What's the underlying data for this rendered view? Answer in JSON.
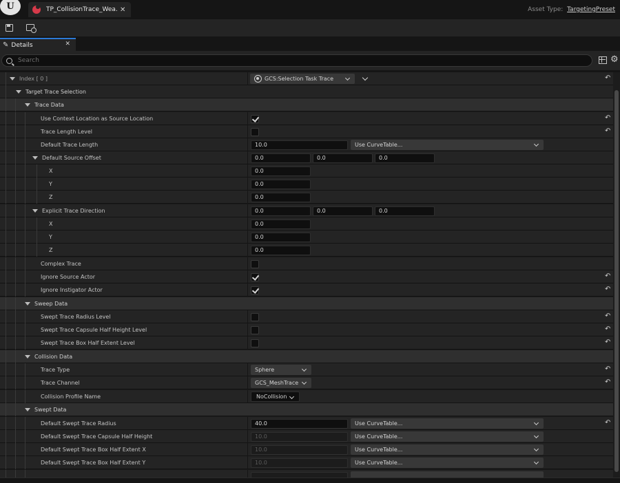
{
  "window": {
    "tab_title": "TP_CollisionTrace_Wea...",
    "tab_close": "✕",
    "asset_type_label": "Asset Type:",
    "asset_type_value": "TargetingPreset"
  },
  "panel": {
    "tab_label": "Details",
    "tab_close": "✕",
    "search_placeholder": "Search"
  },
  "index_row": {
    "label": "Index [ 0 ]",
    "task_value": "GCS:Selection Task Trace"
  },
  "categories": {
    "target_trace_selection": "Target Trace Selection",
    "trace_data": "Trace Data",
    "sweep_data": "Sweep Data",
    "collision_data": "Collision Data",
    "swept_data": "Swept Data"
  },
  "props": {
    "use_context_location": "Use Context Location as Source Location",
    "trace_length_level": "Trace Length Level",
    "default_trace_length": "Default Trace Length",
    "default_trace_length_value": "10.0",
    "curve_table": "Use CurveTable...",
    "default_source_offset": "Default Source Offset",
    "explicit_trace_direction": "Explicit Trace Direction",
    "x": "X",
    "y": "Y",
    "z": "Z",
    "zero": "0.0",
    "complex_trace": "Complex Trace",
    "ignore_source_actor": "Ignore Source Actor",
    "ignore_instigator_actor": "Ignore Instigator Actor",
    "swept_radius_level": "Swept Trace Radius Level",
    "swept_capsule_level": "Swept Trace Capsule Half Height Level",
    "swept_box_level": "Swept Trace Box Half Extent Level",
    "trace_type": "Trace Type",
    "trace_type_value": "Sphere",
    "trace_channel": "Trace Channel",
    "trace_channel_value": "GCS_MeshTrace",
    "collision_profile": "Collision Profile Name",
    "collision_profile_value": "NoCollision",
    "default_swept_radius": "Default Swept Trace Radius",
    "default_swept_radius_value": "40.0",
    "default_swept_capsule": "Default Swept Trace Capsule Half Height",
    "default_swept_box_x": "Default Swept Trace Box Half Extent X",
    "default_swept_box_y": "Default Swept Trace Box Half Extent Y",
    "dim_value": "10.0"
  },
  "icons": {
    "reset": "↶",
    "gear": "⚙",
    "pencil": "✎",
    "engine_logo": "U"
  },
  "colors": {
    "accent": "#2b7ad6",
    "asset_icon": "#d63a4a"
  }
}
